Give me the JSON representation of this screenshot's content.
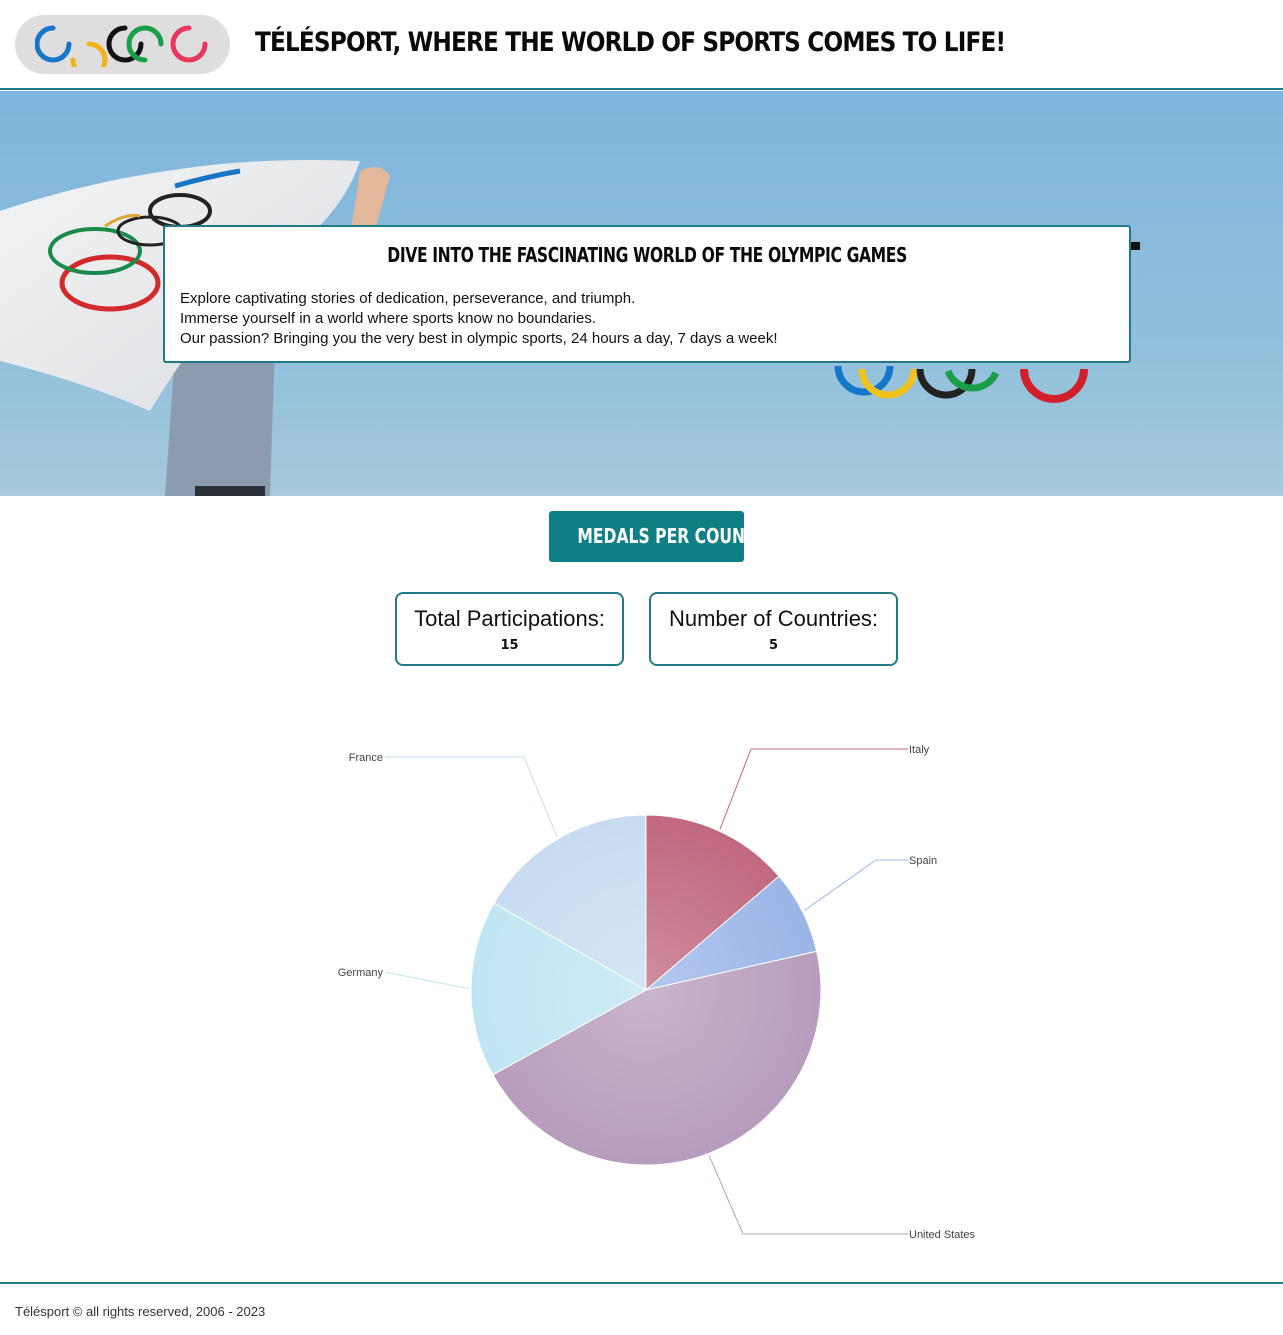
{
  "header": {
    "title": "Télésport, where the world of sports comes to life!",
    "logo_icon": "olympic-rings-icon"
  },
  "hero": {
    "heading": "Dive into the fascinating world of the Olympic Games",
    "lines": [
      "Explore captivating stories of dedication, perseverance, and triumph.",
      "Immerse yourself in a world where sports know no boundaries.",
      "Our passion? Bringing you the very best in olympic sports, 24 hours a day, 7 days a week!"
    ]
  },
  "medals_badge": "Medals per country",
  "stats": {
    "participations_label": "Total Participations:",
    "participations_value": "15",
    "countries_label": "Number of Countries:",
    "countries_value": "5"
  },
  "chart_data": {
    "type": "pie",
    "categories": [
      "Italy",
      "Spain",
      "United States",
      "Germany",
      "France"
    ],
    "values": [
      96,
      54,
      318,
      114,
      117
    ],
    "colors": [
      "#c0687e",
      "#9bb5e8",
      "#b89cbd",
      "#bfe5f4",
      "#c8dcf1"
    ]
  },
  "colors": {
    "accent": "#1f7b85",
    "badge": "#0f7f86"
  },
  "footer": {
    "copyright": "Télésport © all rights reserved, 2006 - 2023"
  }
}
